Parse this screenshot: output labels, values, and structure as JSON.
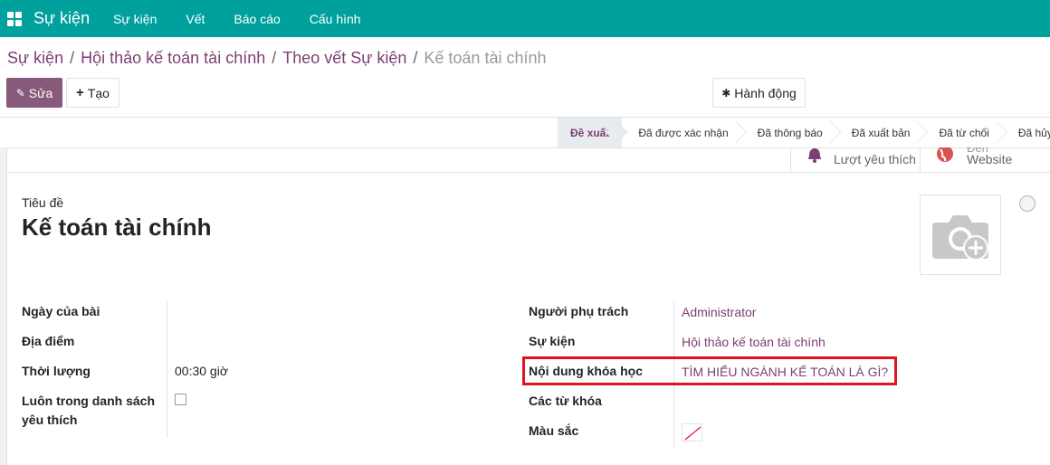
{
  "navbar": {
    "brand": "Sự kiện",
    "menu": [
      "Sự kiện",
      "Vết",
      "Báo cáo",
      "Cấu hình"
    ]
  },
  "breadcrumb": {
    "items": [
      "Sự kiện",
      "Hội thảo kế toán tài chính",
      "Theo vết Sự kiện"
    ],
    "current": "Kế toán tài chính"
  },
  "controls": {
    "edit_label": "Sửa",
    "create_label": "Tạo",
    "action_label": "Hành động"
  },
  "statusbar": {
    "stages": [
      "Đề xuất",
      "Đã được xác nhận",
      "Đã thông báo",
      "Đã xuất bản",
      "Đã từ chối",
      "Đã hủy"
    ],
    "active": "Đề xuất"
  },
  "smart_buttons": {
    "favorites_label": "Lượt yêu thích",
    "website_top": "Đến",
    "website_label": "Website"
  },
  "form": {
    "title_label": "Tiêu đề",
    "title_value": "Kế toán tài chính",
    "left": {
      "date_label": "Ngày của bài",
      "location_label": "Địa điểm",
      "duration_label": "Thời lượng",
      "duration_value": "00:30 giờ",
      "favorite_label_1": "Luôn trong danh sách",
      "favorite_label_2": "yêu thích"
    },
    "right": {
      "responsible_label": "Người phụ trách",
      "responsible_value": "Administrator",
      "event_label": "Sự kiện",
      "event_value": "Hội thảo kế toán tài chính",
      "content_label": "Nội dung khóa học",
      "content_value": "TÌM HIỂU NGÀNH KẾ TOÁN LÀ GÌ?",
      "tags_label": "Các từ khóa",
      "color_label": "Màu sắc"
    }
  },
  "colors": {
    "navbar": "#00a09d",
    "primary": "#875a7b",
    "link": "#7c3e73",
    "highlight": "#e0141e"
  }
}
